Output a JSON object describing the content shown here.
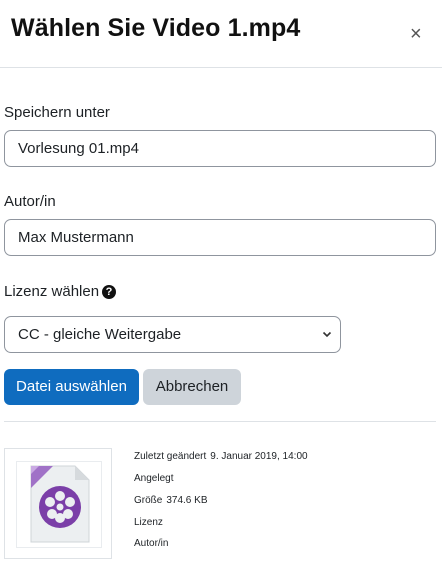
{
  "dialog": {
    "title": "Wählen Sie Video 1.mp4",
    "close_symbol": "×"
  },
  "form": {
    "save_as_label": "Speichern unter",
    "save_as_value": "Vorlesung 01.mp4",
    "author_label": "Autor/in",
    "author_value": "Max Mustermann",
    "license_label": "Lizenz wählen",
    "license_help": "?",
    "license_selected": "CC - gleiche Weitergabe"
  },
  "buttons": {
    "select_file": "Datei auswählen",
    "cancel": "Abbrechen"
  },
  "file_info": {
    "modified_label": "Zuletzt geändert",
    "modified_value": "9. Januar 2019, 14:00",
    "created_label": "Angelegt",
    "size_label": "Größe",
    "size_value": "374.6 KB",
    "license_label": "Lizenz",
    "author_label": "Autor/in"
  },
  "icons": {
    "thumbnail": "video-file-icon",
    "help": "help-icon",
    "close": "close-icon",
    "dropdown": "chevron-down-icon"
  },
  "colors": {
    "primary": "#0f6cbf",
    "secondary": "#ced4da",
    "video_icon": "#7b3fa8"
  }
}
